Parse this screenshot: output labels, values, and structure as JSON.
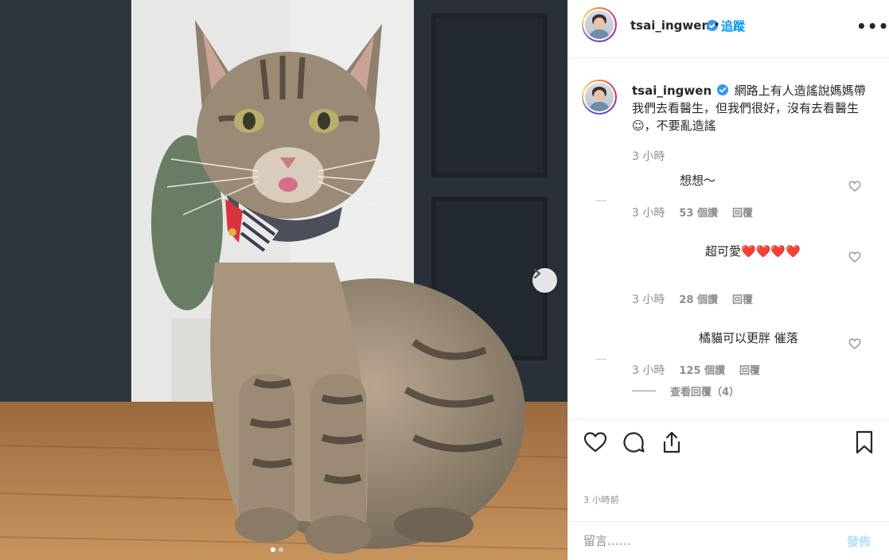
{
  "post": {
    "username": "tsai_ingwen",
    "follow_label": "追蹤",
    "separator": "•",
    "more_label": "•••",
    "caption": "網路上有人造謠說媽媽帶我們去看醫生，但我們很好，沒有去看醫生☺，不要亂造謠",
    "caption_time": "3 小時",
    "posted_ago": "3 小時前"
  },
  "comments": [
    {
      "text": "想想～",
      "time": "3 小時",
      "likes": "53 個讚",
      "reply": "回覆"
    },
    {
      "text": "超可愛❤️❤️❤️❤️",
      "time": "3 小時",
      "likes": "28 個讚",
      "reply": "回覆"
    },
    {
      "text": "橘貓可以更胖 催落",
      "time": "3 小時",
      "likes": "125 個讚",
      "reply": "回覆"
    }
  ],
  "view_replies": "查看回覆（4）",
  "compose": {
    "placeholder": "留言……",
    "post_label": "發佈"
  },
  "carousel": {
    "total": 2,
    "current": 1
  },
  "icons": [
    "verified-badge-icon",
    "more-options-icon",
    "heart-icon",
    "comment-icon",
    "share-icon",
    "bookmark-icon",
    "chevron-right-icon"
  ],
  "colors": {
    "accent": "#0095f6",
    "verified": "#3897f0",
    "muted": "#8e8e8e",
    "post_disabled": "#b2dffc"
  }
}
